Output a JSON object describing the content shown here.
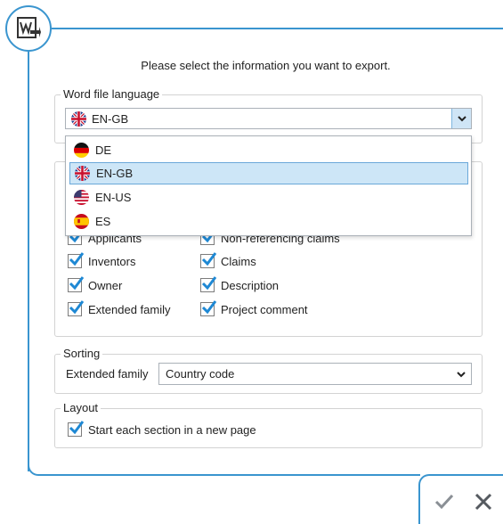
{
  "dialog": {
    "instruction": "Please select the information you want to export."
  },
  "language": {
    "legend": "Word file language",
    "selected": "EN-GB",
    "options": [
      "DE",
      "EN-GB",
      "EN-US",
      "ES"
    ],
    "highlighted_option": "EN-GB"
  },
  "content": {
    "partial_left_label": "Applicants",
    "partial_right_label": "Non-referencing claims",
    "left_items": [
      {
        "label": "Inventors",
        "checked": true
      },
      {
        "label": "Owner",
        "checked": true
      },
      {
        "label": "Extended family",
        "checked": true
      }
    ],
    "right_items": [
      {
        "label": "Claims",
        "checked": true
      },
      {
        "label": "Description",
        "checked": true
      },
      {
        "label": "Project comment",
        "checked": true
      }
    ]
  },
  "sorting": {
    "legend": "Sorting",
    "row_label": "Extended family",
    "selected": "Country code"
  },
  "layout": {
    "legend": "Layout",
    "checkbox_label": "Start each section in a new page",
    "checked": true
  },
  "colors": {
    "accent": "#3a95cf",
    "check": "#1e88d4",
    "selection": "#cde6f7"
  }
}
